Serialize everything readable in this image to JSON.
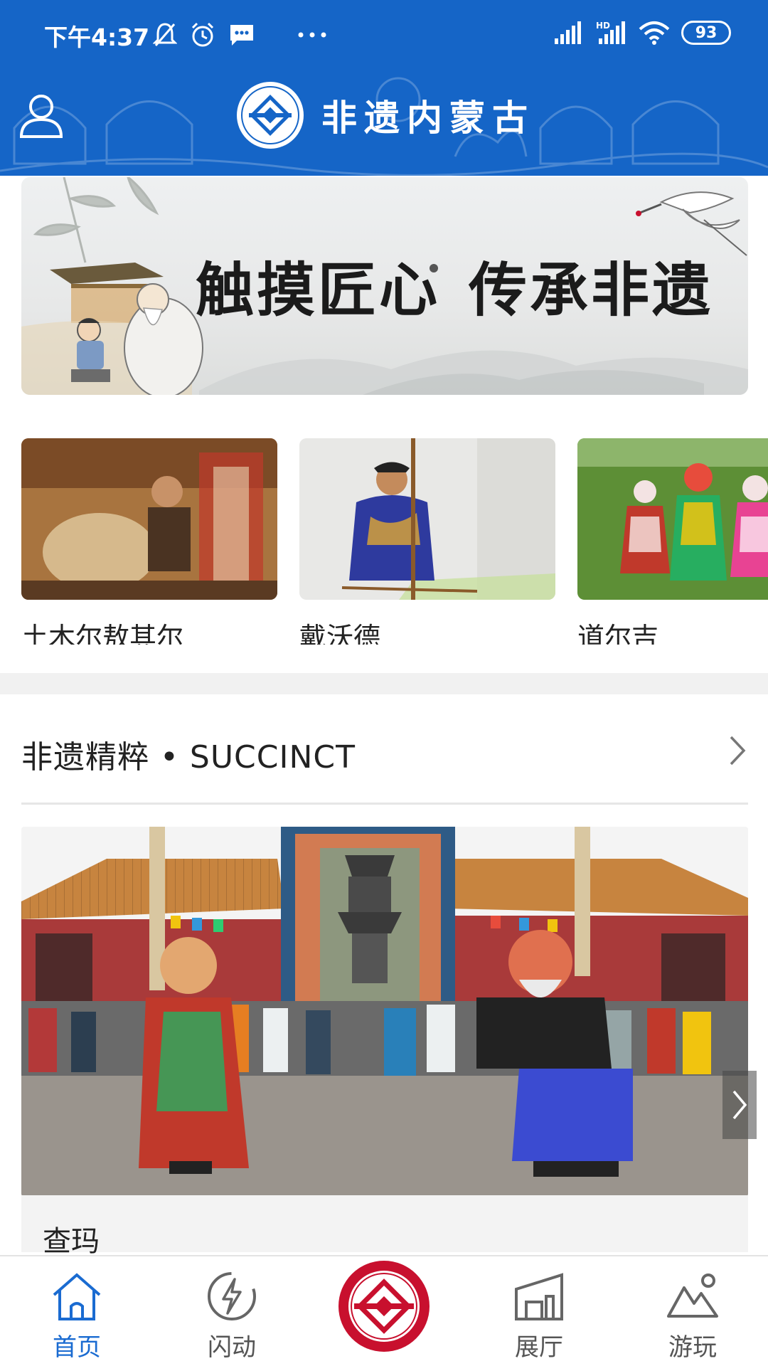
{
  "status_bar": {
    "time": "下午4:37",
    "battery": "93",
    "network": "HD"
  },
  "header": {
    "title": "非遗内蒙古",
    "user_icon": "user-icon",
    "color": "#1565c7"
  },
  "banner": {
    "slogan_black_1": "触摸匠心",
    "slogan_black_2": "传承非遗"
  },
  "categories": [
    {
      "label": "土木尔敖其尔"
    },
    {
      "label": "戴沃德"
    },
    {
      "label": "道尔吉"
    }
  ],
  "section": {
    "title": "非遗精粹 • SUCCINCT",
    "chevron_icon": "chevron-right-icon"
  },
  "feature": {
    "caption": "查玛",
    "next_icon": "chevron-right-icon"
  },
  "tabs": [
    {
      "label": "首页",
      "icon": "home-icon",
      "active": true
    },
    {
      "label": "闪动",
      "icon": "lightning-icon",
      "active": false
    },
    {
      "label": "展厅",
      "icon": "gallery-icon",
      "active": false
    },
    {
      "label": "游玩",
      "icon": "mountain-icon",
      "active": false
    }
  ],
  "colors": {
    "primary": "#1565c7",
    "active_tab": "#1a6bd1",
    "accent_red": "#c8102e"
  }
}
